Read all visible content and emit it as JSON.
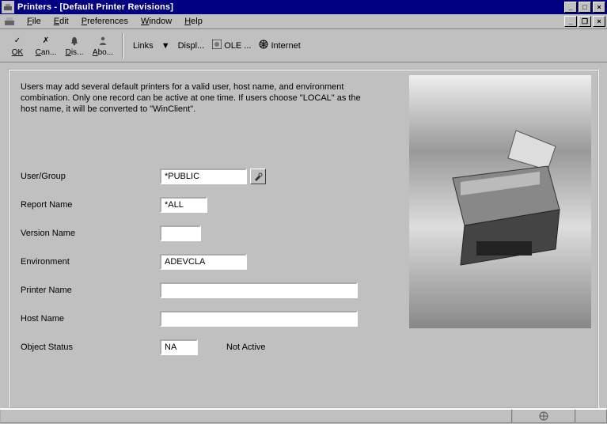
{
  "window": {
    "title": "Printers - [Default Printer Revisions]"
  },
  "menu": {
    "file": "File",
    "edit": "Edit",
    "preferences": "Preferences",
    "window": "Window",
    "help": "Help"
  },
  "toolbar": {
    "ok": "OK",
    "cancel": "Can...",
    "display": "Dis...",
    "about": "Abo...",
    "links": "Links",
    "displ": "Displ...",
    "ole": "OLE ...",
    "internet": "Internet"
  },
  "instructions": "Users may add several default printers for a valid user, host name, and environment combination.  Only one record can be active at one time.  If users choose \"LOCAL\" as the host name, it will be converted to \"WinClient\".",
  "labels": {
    "user_group": "User/Group",
    "report_name": "Report Name",
    "version_name": "Version Name",
    "environment": "Environment",
    "printer_name": "Printer Name",
    "host_name": "Host Name",
    "object_status": "Object Status"
  },
  "values": {
    "user_group": "*PUBLIC",
    "report_name": "*ALL",
    "version_name": "",
    "environment": "ADEVCLA",
    "printer_name": "",
    "host_name": "",
    "object_status": "NA",
    "object_status_desc": "Not Active"
  }
}
